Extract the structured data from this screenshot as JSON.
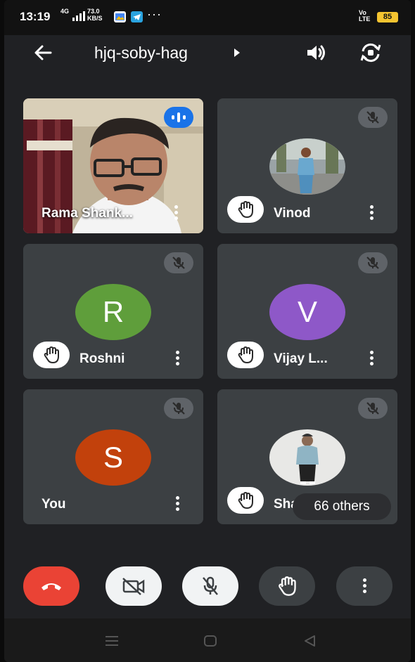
{
  "status_bar": {
    "time": "13:19",
    "network": "4G",
    "speed_value": "73.0",
    "speed_unit": "KB/S",
    "overflow": "···",
    "volte_top": "Vo",
    "volte_bottom": "LTE",
    "battery": "85"
  },
  "header": {
    "meeting_code": "hjq-soby-hag"
  },
  "participants": [
    {
      "name": "Rama Shank...",
      "type": "video",
      "speaking": true
    },
    {
      "name": "Vinod",
      "type": "photo",
      "muted": true,
      "hand_raised": true
    },
    {
      "name": "Roshni",
      "type": "letter",
      "initial": "R",
      "color": "#5f9e3b",
      "muted": true,
      "hand_raised": true
    },
    {
      "name": "Vijay L...",
      "type": "letter",
      "initial": "V",
      "color": "#8e58c8",
      "muted": true,
      "hand_raised": true
    },
    {
      "name": "You",
      "type": "letter",
      "initial": "S",
      "color": "#c2410c",
      "muted": true,
      "hand_raised": false
    },
    {
      "name": "Shankar",
      "type": "photo",
      "muted": true,
      "hand_raised": true
    }
  ],
  "others_count": "66 others",
  "colors": {
    "background": "#202124",
    "tile": "#3c4043",
    "end_call": "#ea4335",
    "speaking": "#1a73e8"
  }
}
